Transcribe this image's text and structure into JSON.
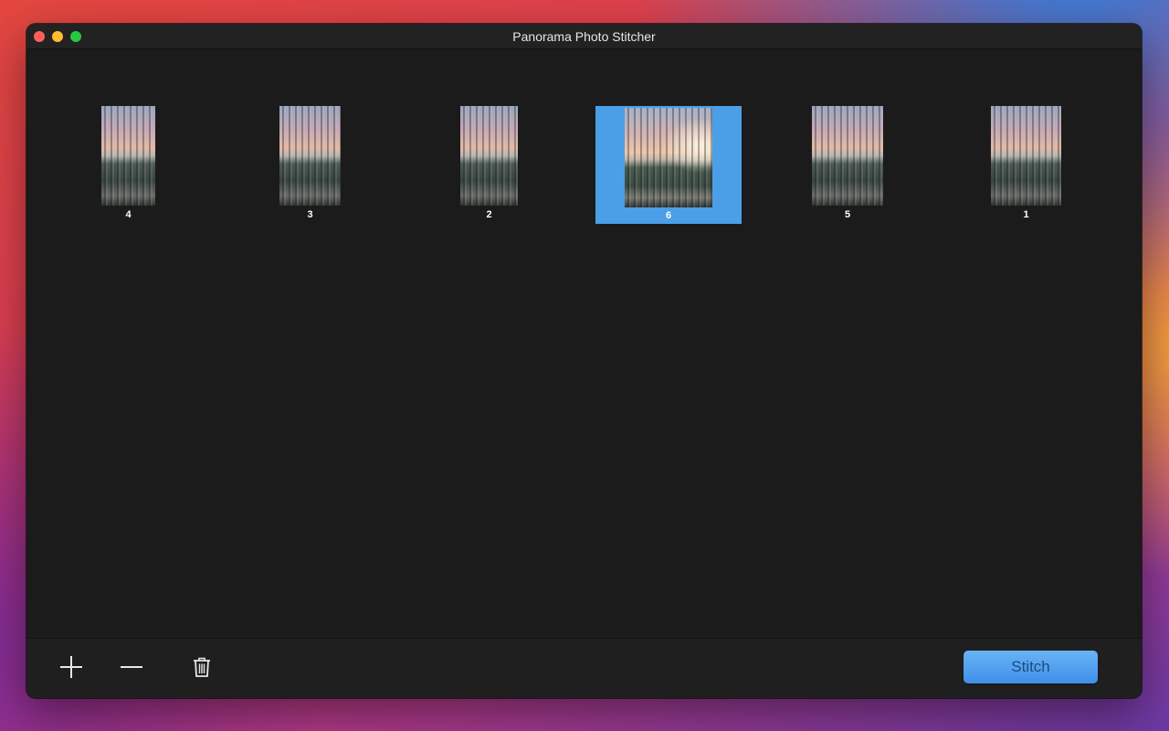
{
  "window": {
    "title": "Panorama Photo Stitcher"
  },
  "photos": [
    {
      "label": "4",
      "selected": false
    },
    {
      "label": "3",
      "selected": false
    },
    {
      "label": "2",
      "selected": false
    },
    {
      "label": "6",
      "selected": true
    },
    {
      "label": "5",
      "selected": false
    },
    {
      "label": "1",
      "selected": false
    }
  ],
  "toolbar": {
    "add_icon": "plus-icon",
    "remove_icon": "minus-icon",
    "delete_icon": "trash-icon",
    "stitch_label": "Stitch"
  },
  "colors": {
    "selection": "#4a9fe6",
    "stitch_button": "#4f9ff0",
    "window_bg": "#1b1b1b"
  }
}
